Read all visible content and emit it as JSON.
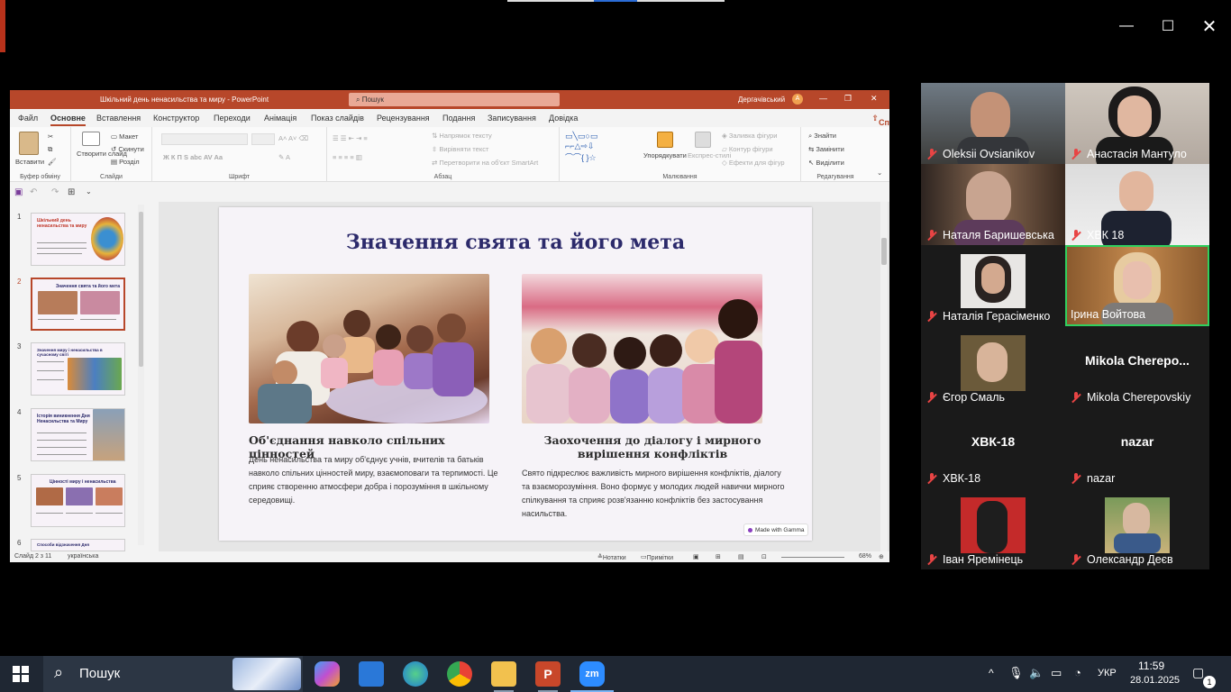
{
  "powerpoint": {
    "title": "Шкільний день ненасильства та миру - PowerPoint",
    "search_label": "Пошук",
    "user": "Дергачівський",
    "menu": [
      "Файл",
      "Основне",
      "Вставлення",
      "Конструктор",
      "Переходи",
      "Анімація",
      "Показ слайдів",
      "Рецензування",
      "Подання",
      "Записування",
      "Довідка"
    ],
    "share": "Спільний доступ",
    "ribbon": {
      "paste": "Вставити",
      "clipboard": "Буфер обміну",
      "new_slide": "Створити слайд",
      "layout": "Макет",
      "reset": "Скинути",
      "section": "Розділ",
      "slides": "Слайди",
      "font": "Шрифт",
      "text_direction": "Напрямок тексту",
      "align_text": "Вирівняти текст",
      "smartart": "Перетворити на об'єкт SmartArt",
      "paragraph": "Абзац",
      "arrange": "Упорядкувати",
      "quick_styles": "Експрес-стилі",
      "shape_fill": "Заливка фігури",
      "shape_outline": "Контур фігури",
      "shape_effects": "Ефекти для фігур",
      "drawing": "Малювання",
      "find": "Знайти",
      "replace": "Замінити",
      "select": "Виділити",
      "editing": "Редагування"
    },
    "thumb_numbers": [
      "1",
      "2",
      "3",
      "4",
      "5",
      "6"
    ],
    "thumb_titles": [
      "Шкільний день ненасильства та миру",
      "Значення свята та його мета",
      "Значення миру і ненасильства в сучасному світі",
      "Історія виникнення Дня Ненасильства та Миру",
      "Цінності миру і ненасильства",
      "Способи відзначення Дня"
    ],
    "slide": {
      "title": "Значення свята та його мета",
      "left_heading": "Об'єднання навколо спільних цінностей",
      "left_body": "День ненасильства та миру об'єднує учнів, вчителів та батьків навколо спільних цінностей миру, взаємоповаги та терпимості. Це сприяє створенню атмосфери добра і порозуміння в шкільному середовищі.",
      "right_heading": "Заохочення до діалогу і мирного вирішення конфліктів",
      "right_body": "Свято підкреслює важливість мирного вирішення конфліктів, діалогу та взаєморозуміння. Воно формує у молодих людей навички мирного спілкування та сприяє розв'язанню конфліктів без застосування насильства.",
      "made_with": "Made with Gamma"
    },
    "status": {
      "slide_counter": "Слайд 2 з 11",
      "language": "українська",
      "notes": "Нотатки",
      "comments": "Примітки",
      "zoom": "68%"
    }
  },
  "zoom": {
    "participants": [
      {
        "name": "Oleksii Ovsianikov",
        "muted": true
      },
      {
        "name": "Анастасія Мантуло",
        "muted": true
      },
      {
        "name": "Наталя Баришевська",
        "muted": true
      },
      {
        "name": "ХВК 18",
        "muted": true
      },
      {
        "name": "Наталія Герасіменко",
        "muted": true
      },
      {
        "name": "Ірина Войтова",
        "muted": false
      },
      {
        "name": "Єгор Смаль",
        "muted": true
      },
      {
        "name": "Mikola Cherepovskiy",
        "muted": true,
        "display": "Mikola  Cherepo..."
      },
      {
        "name": "ХВК-18",
        "muted": true,
        "display": "ХВК-18"
      },
      {
        "name": "nazar",
        "muted": true,
        "display": "nazar"
      },
      {
        "name": "Іван Яремінець",
        "muted": true
      },
      {
        "name": "Олександр Деєв",
        "muted": true
      }
    ]
  },
  "taskbar": {
    "search_label": "Пошук",
    "language": "УКР",
    "time": "11:59",
    "date": "28.01.2025",
    "notifications": "1"
  },
  "colors": {
    "ppt_accent": "#b7472a",
    "slide_title": "#2c2a6b",
    "active_speaker": "#2fd05f"
  }
}
